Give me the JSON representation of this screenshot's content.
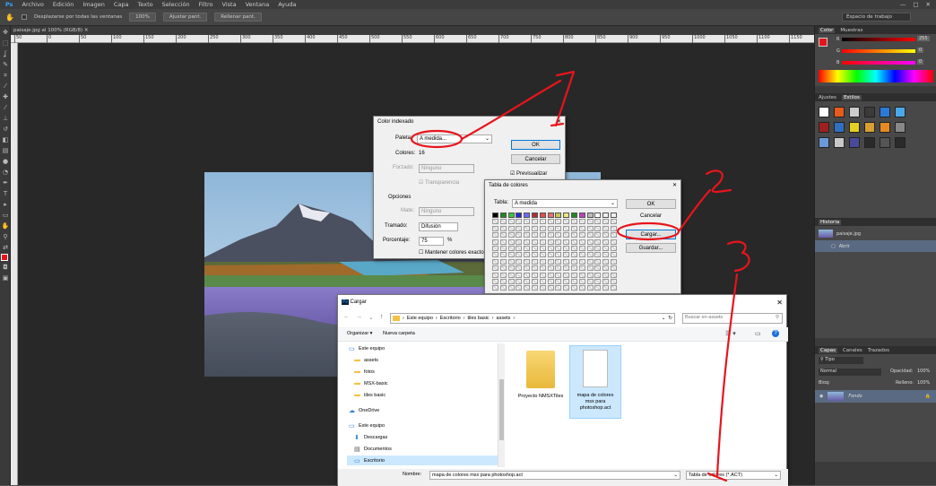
{
  "menubar": {
    "ps_logo": "Ps",
    "items": [
      "Archivo",
      "Edición",
      "Imagen",
      "Capa",
      "Texto",
      "Selección",
      "Filtro",
      "Vista",
      "Ventana",
      "Ayuda"
    ]
  },
  "options": {
    "checkbox_label": "Desplazarse por todas las ventanas",
    "btn1": "100%",
    "btn2": "Ajustar pant.",
    "btn3": "Rellenar pant.",
    "workspace": "Espacio de trabajo"
  },
  "document": {
    "tab": "paisaje.jpg al 100% (RGB/8)",
    "ruler_ticks": [
      "50",
      "0",
      "50",
      "100",
      "150",
      "200",
      "250",
      "300",
      "350",
      "400",
      "450",
      "500",
      "550",
      "600",
      "650",
      "700",
      "750",
      "800",
      "850",
      "900",
      "950",
      "1000",
      "1050",
      "1100",
      "1150"
    ]
  },
  "color_panel": {
    "tabs": [
      "Color",
      "Muestras"
    ],
    "r_label": "R",
    "g_label": "G",
    "b_label": "B",
    "r_value": "255",
    "g_value": "0",
    "b_value": "0"
  },
  "styles_panel": {
    "tabs": [
      "Ajustes",
      "Estilos"
    ]
  },
  "history_panel": {
    "title": "Historia",
    "snapshot": "paisaje.jpg",
    "step": "Abrir"
  },
  "layers_panel": {
    "tabs": [
      "Capas",
      "Canales",
      "Trazados"
    ],
    "kind": "Tipo",
    "blend": "Normal",
    "opacity_label": "Opacidad:",
    "opacity": "100%",
    "lock_label": "Bloq:",
    "fill_label": "Relleno:",
    "fill": "100%",
    "layer": "Fondo"
  },
  "indexed_dialog": {
    "title": "Color indexado",
    "palette_label": "Paleta:",
    "palette_value": "A medida...",
    "colors_label": "Colores:",
    "colors_value": "16",
    "forced_label": "Forzado:",
    "forced_value": "Ninguno",
    "transparency": "Transparencia",
    "options_label": "Opciones",
    "matte_label": "Mate:",
    "matte_value": "Ninguno",
    "dither_label": "Tramado:",
    "dither_value": "Difusión",
    "amount_label": "Porcentaje:",
    "amount_value": "75",
    "percent": "%",
    "preserve": "Mantener colores exactos",
    "ok": "OK",
    "cancel": "Cancelar",
    "preview": "Previsualizar"
  },
  "color_table_dialog": {
    "title": "Tabla de colores",
    "table_label": "Tabla:",
    "table_value": "A medida",
    "ok": "OK",
    "cancel": "Cancelar",
    "load": "Cargar...",
    "save": "Guardar...",
    "swatches": [
      "#000000",
      "#1e8a1e",
      "#3cc83c",
      "#2a2ad0",
      "#6b6bff",
      "#b03030",
      "#e05050",
      "#e87070",
      "#c8c850",
      "#e8e880",
      "#228822",
      "#c040c0",
      "#bbbbbb",
      "#ffffff"
    ]
  },
  "load_dialog": {
    "title": "Cargar",
    "breadcrumb": [
      "Este equipo",
      "Escritorio",
      "tiles basic",
      "assets"
    ],
    "search_placeholder": "Buscar en assets",
    "organize": "Organizar",
    "new_folder": "Nueva carpeta",
    "tree": [
      {
        "label": "Este equipo",
        "icon": "pc"
      },
      {
        "label": "assets",
        "icon": "folder"
      },
      {
        "label": "fotos",
        "icon": "folder"
      },
      {
        "label": "MSX-basic",
        "icon": "folder"
      },
      {
        "label": "tiles basic",
        "icon": "folder"
      },
      {
        "label": "OneDrive",
        "icon": "cloud"
      },
      {
        "label": "Este equipo",
        "icon": "pc"
      },
      {
        "label": "Descargas",
        "icon": "download"
      },
      {
        "label": "Documentos",
        "icon": "doc"
      },
      {
        "label": "Escritorio",
        "icon": "desktop"
      }
    ],
    "files": [
      {
        "name": "Proyecto NMSXTiles",
        "type": "folder"
      },
      {
        "name": "mapa de colores msx para photoshop.act",
        "type": "file"
      }
    ],
    "filename_label": "Nombre:",
    "filename_value": "mapa de colores msx para photoshop.act",
    "filetype": "Tabla de colores (*.ACT)"
  },
  "annotations": [
    "1",
    "2",
    "3"
  ],
  "colors": {
    "accent": "#e8141c"
  }
}
